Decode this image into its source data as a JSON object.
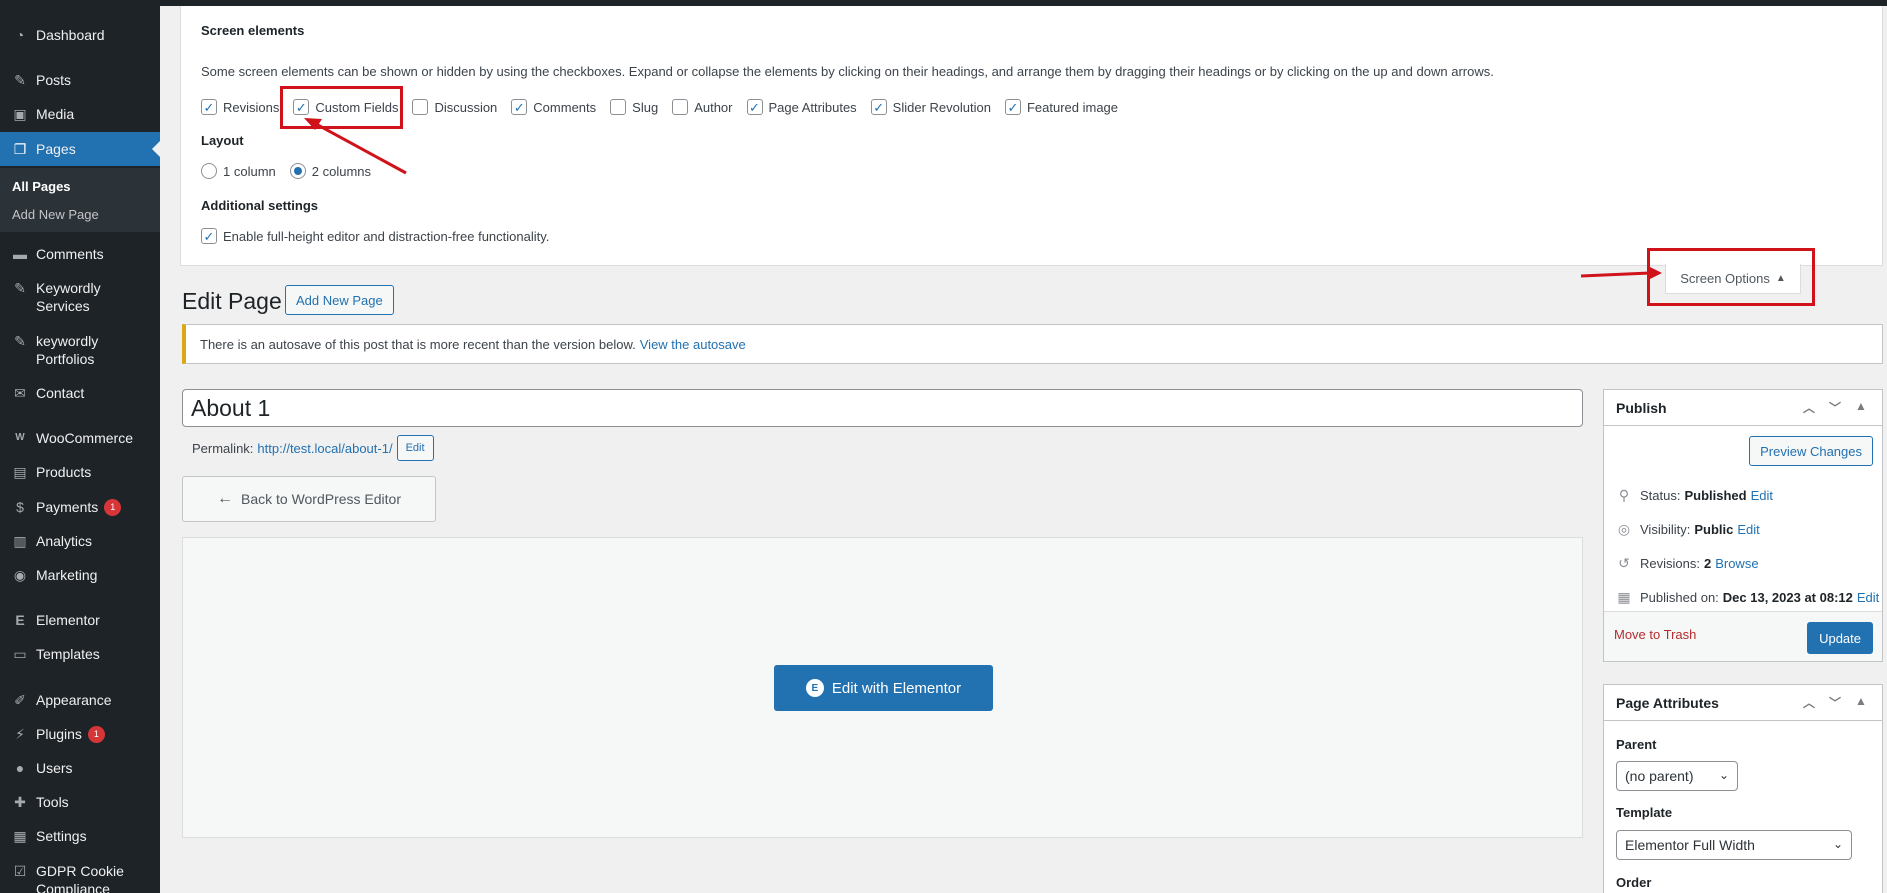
{
  "sidebar": {
    "items": [
      {
        "label": "Dashboard",
        "icon": "dashboard-icon",
        "glyph": "◔"
      },
      {
        "label": "Posts",
        "icon": "pushpin-icon",
        "glyph": "✎"
      },
      {
        "label": "Media",
        "icon": "media-icon",
        "glyph": "▣"
      },
      {
        "label": "Pages",
        "icon": "pages-icon",
        "glyph": "❐"
      },
      {
        "label": "Comments",
        "icon": "comments-icon",
        "glyph": "▬"
      },
      {
        "label": "Keywordly Services",
        "line1": "Keywordly",
        "line2": "Services",
        "icon": "pushpin-icon",
        "glyph": "✎"
      },
      {
        "label": "keywordly Portfolios",
        "line1": "keywordly",
        "line2": "Portfolios",
        "icon": "pushpin-icon",
        "glyph": "✎"
      },
      {
        "label": "Contact",
        "icon": "mail-icon",
        "glyph": "✉"
      },
      {
        "label": "WooCommerce",
        "icon": "woocommerce-icon",
        "glyph": "W"
      },
      {
        "label": "Products",
        "icon": "products-icon",
        "glyph": "▤"
      },
      {
        "label": "Payments",
        "icon": "payments-icon",
        "glyph": "$",
        "badge": "1"
      },
      {
        "label": "Analytics",
        "icon": "analytics-icon",
        "glyph": "▥"
      },
      {
        "label": "Marketing",
        "icon": "marketing-icon",
        "glyph": "◉"
      },
      {
        "label": "Elementor",
        "icon": "elementor-icon",
        "glyph": "E"
      },
      {
        "label": "Templates",
        "icon": "folder-icon",
        "glyph": "▭"
      },
      {
        "label": "Appearance",
        "icon": "brush-icon",
        "glyph": "✐"
      },
      {
        "label": "Plugins",
        "icon": "plugin-icon",
        "glyph": "⚡",
        "badge": "1"
      },
      {
        "label": "Users",
        "icon": "users-icon",
        "glyph": "●"
      },
      {
        "label": "Tools",
        "icon": "wrench-icon",
        "glyph": "✚"
      },
      {
        "label": "Settings",
        "icon": "settings-icon",
        "glyph": "▦"
      },
      {
        "label": "GDPR Cookie Compliance",
        "line1": "GDPR Cookie",
        "line2": "Compliance",
        "icon": "checkbox-icon",
        "glyph": "☑"
      }
    ],
    "submenu": [
      "All Pages",
      "Add New Page"
    ]
  },
  "screen_options": {
    "elements_heading": "Screen elements",
    "description": "Some screen elements can be shown or hidden by using the checkboxes. Expand or collapse the elements by clicking on their headings, and arrange them by dragging their headings or by clicking on the up and down arrows.",
    "checkboxes": [
      {
        "label": "Revisions",
        "checked": true
      },
      {
        "label": "Custom Fields",
        "checked": true
      },
      {
        "label": "Discussion",
        "checked": false
      },
      {
        "label": "Comments",
        "checked": true
      },
      {
        "label": "Slug",
        "checked": false
      },
      {
        "label": "Author",
        "checked": false
      },
      {
        "label": "Page Attributes",
        "checked": true
      },
      {
        "label": "Slider Revolution",
        "checked": true
      },
      {
        "label": "Featured image",
        "checked": true
      }
    ],
    "layout_heading": "Layout",
    "layout_options": [
      {
        "label": "1 column",
        "selected": false
      },
      {
        "label": "2 columns",
        "selected": true
      }
    ],
    "additional_heading": "Additional settings",
    "additional_option": {
      "label": "Enable full-height editor and distraction-free functionality.",
      "checked": true
    },
    "toggle_label": "Screen Options",
    "toggle_arrow": "▲"
  },
  "header": {
    "title": "Edit Page",
    "add_new": "Add New Page"
  },
  "notice": {
    "text": "There is an autosave of this post that is more recent than the version below.",
    "link": "View the autosave"
  },
  "editor": {
    "title_value": "About 1",
    "permalink_label": "Permalink:",
    "permalink_url": "http://test.local/about-1/",
    "permalink_edit": "Edit",
    "back_button": "Back to WordPress Editor",
    "elementor_button": "Edit with Elementor"
  },
  "publish": {
    "title": "Publish",
    "preview": "Preview Changes",
    "status_label": "Status:",
    "status_value": "Published",
    "visibility_label": "Visibility:",
    "visibility_value": "Public",
    "revisions_label": "Revisions:",
    "revisions_value": "2",
    "browse": "Browse",
    "published_label": "Published on:",
    "published_value": "Dec 13, 2023 at 08:12",
    "edit": "Edit",
    "trash": "Move to Trash",
    "update": "Update"
  },
  "page_attributes": {
    "title": "Page Attributes",
    "parent_label": "Parent",
    "parent_value": "(no parent)",
    "template_label": "Template",
    "template_value": "Elementor Full Width",
    "order_label": "Order"
  },
  "colors": {
    "sidebar_bg": "#1d2327",
    "accent": "#2271b1",
    "annotation": "#d0121b"
  }
}
